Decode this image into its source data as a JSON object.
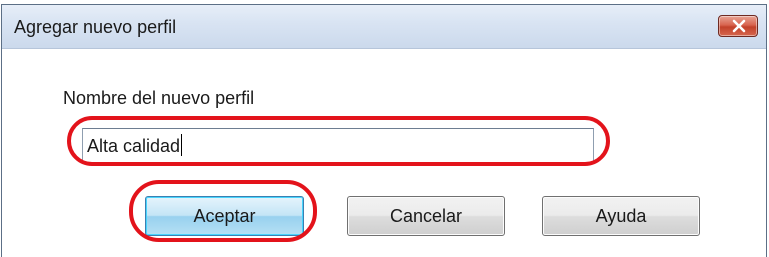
{
  "window": {
    "title": "Agregar nuevo perfil",
    "close_icon": "close-icon"
  },
  "form": {
    "label": "Nombre del nuevo perfil",
    "name_value": "Alta calidad"
  },
  "buttons": {
    "accept": "Aceptar",
    "cancel": "Cancelar",
    "help": "Ayuda"
  },
  "colors": {
    "highlight": "#e3131b",
    "close_button": "#c2412a",
    "default_button": "#98d1ef"
  }
}
